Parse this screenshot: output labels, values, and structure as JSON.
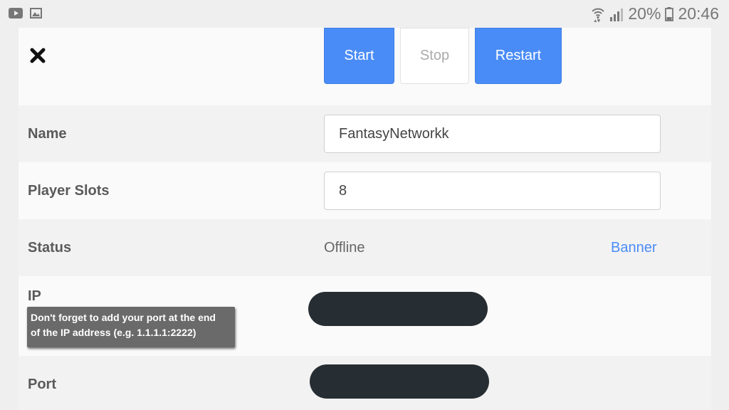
{
  "status_bar": {
    "battery": "20%",
    "time": "20:46"
  },
  "toolbar": {
    "start_label": "Start",
    "stop_label": "Stop",
    "restart_label": "Restart"
  },
  "fields": {
    "name_label": "Name",
    "name_value": "FantasyNetworkk",
    "slots_label": "Player Slots",
    "slots_value": "8",
    "status_label": "Status",
    "status_value": "Offline",
    "banner_link": "Banner",
    "ip_label": "IP",
    "ip_tooltip_line1": "Don't forget to add your port at the end",
    "ip_tooltip_line2": "of the IP address (e.g. 1.1.1.1:2222)",
    "port_label": "Port"
  },
  "colors": {
    "primary": "#4a8cf7",
    "redaction": "#272e33"
  },
  "icons": {
    "status_left": [
      "youtube-icon",
      "image-icon"
    ],
    "status_right": [
      "wifi-icon",
      "signal-icon",
      "battery-icon"
    ],
    "close": "close-icon"
  }
}
